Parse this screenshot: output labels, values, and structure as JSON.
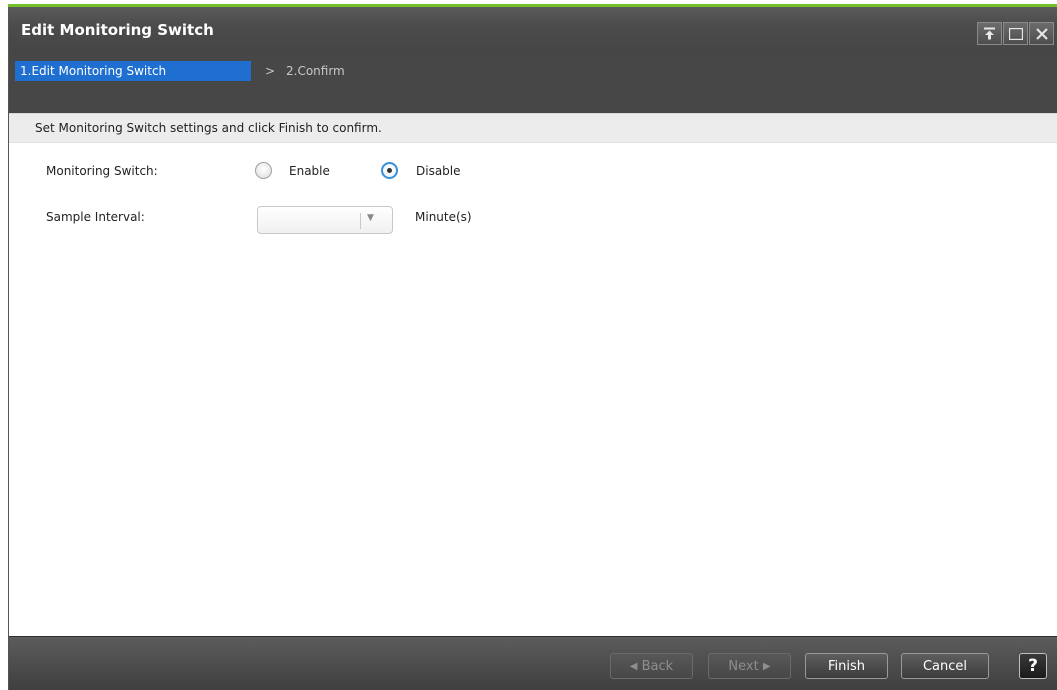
{
  "window": {
    "title": "Edit Monitoring Switch",
    "buttons": [
      "pin-icon",
      "maximize-icon",
      "close-icon"
    ]
  },
  "steps": {
    "step1": "1.Edit Monitoring Switch",
    "separator": ">",
    "step2": "2.Confirm"
  },
  "instruction": "Set Monitoring Switch settings and click Finish to confirm.",
  "form": {
    "monitoring_switch_label": "Monitoring Switch:",
    "enable_label": "Enable",
    "disable_label": "Disable",
    "selected": "Disable",
    "sample_interval_label": "Sample Interval:",
    "sample_interval_value": "",
    "unit_label": "Minute(s)"
  },
  "footer": {
    "back_label": "Back",
    "next_label": "Next",
    "finish_label": "Finish",
    "cancel_label": "Cancel",
    "help_label": "?"
  },
  "colors": {
    "accent_green": "#72c02c",
    "step_active": "#1f6fd1",
    "radio_focus": "#3a8fd8"
  }
}
